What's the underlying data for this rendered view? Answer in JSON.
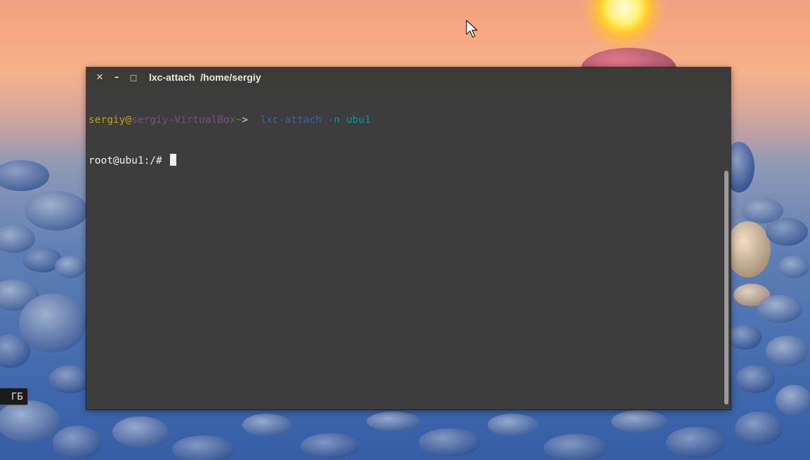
{
  "desktop": {
    "badge_text": "ГБ"
  },
  "terminal": {
    "title": "lxc-attach  /home/sergiy",
    "buttons": {
      "close_icon": "✕",
      "minimize_icon": "–",
      "maximize_icon": "□"
    },
    "lines": [
      {
        "user": "sergiy",
        "at": "@",
        "host": "sergiy-VirtualBox",
        "tilde": "~",
        "gt": ">",
        "cmd": "lxc-attach",
        "args": "-n ubu1"
      },
      {
        "prompt": "root@ubu1:/# "
      }
    ]
  },
  "colors": {
    "terminal_bg": "#3d3d3d",
    "titlebar_bg": "#3c3b37",
    "prompt_user": "#c4a000",
    "prompt_host": "#75507b",
    "prompt_tilde": "#4e9a06",
    "command": "#3465a4",
    "argument": "#06989a"
  }
}
